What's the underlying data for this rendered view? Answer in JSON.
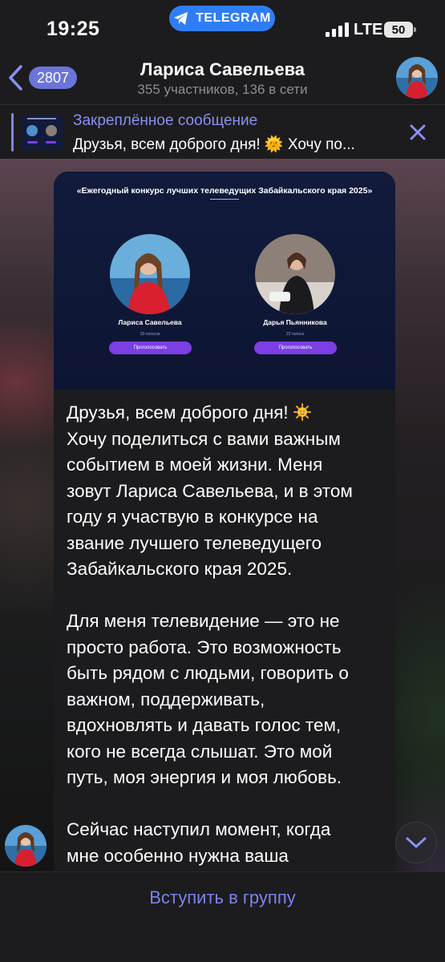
{
  "status_bar": {
    "time": "19:25",
    "app_pill": "TELEGRAM",
    "network": "LTE",
    "battery": "50"
  },
  "header": {
    "back_badge": "2807",
    "title": "Лариса Савельева",
    "subtitle": "355 участников, 136 в сети"
  },
  "pinned": {
    "title": "Закреплённое сообщение",
    "text": "Друзья, всем доброго дня! 🌞 Хочу по..."
  },
  "message": {
    "image": {
      "title": "«Ежегодный конкурс лучших телеведущих Забайкальского края 2025»",
      "candidates": [
        {
          "name": "Лариса Савельева",
          "votes": "18 голосов",
          "button": "Проголосовать"
        },
        {
          "name": "Дарья Пьянникова",
          "votes": "23 голоса",
          "button": "Проголосовать"
        }
      ]
    },
    "paragraph_1_a": "Друзья, всем доброго дня! ",
    "paragraph_1_b": "\nХочу поделиться с вами важным\nсобытием в моей жизни. Меня\nзовут Лариса Савельева, и в этом\nгоду я участвую в конкурсе на\nзвание лучшего телеведущего\nЗабайкальского края 2025.",
    "paragraph_2": "Для меня телевидение — это не\nпросто работа. Это возможность\nбыть рядом с людьми, говорить о\nважном, поддерживать,\nвдохновлять и давать голос тем,\nкого не всегда слышат. Это мой\nпуть, моя энергия и моя любовь.",
    "paragraph_3": "Сейчас наступил момент, когда\nмне особенно нужна ваша"
  },
  "bottom": {
    "join_label": "Вступить в группу"
  },
  "colors": {
    "accent": "#7c82ee",
    "badge": "#6b74d9",
    "telegram_pill": "#2f7df6",
    "vote_button": "#7b3fe4"
  },
  "icons": [
    "telegram-icon",
    "signal-icon",
    "battery-icon",
    "back-chevron-icon",
    "close-icon",
    "sun-emoji-icon",
    "chevron-down-icon"
  ]
}
